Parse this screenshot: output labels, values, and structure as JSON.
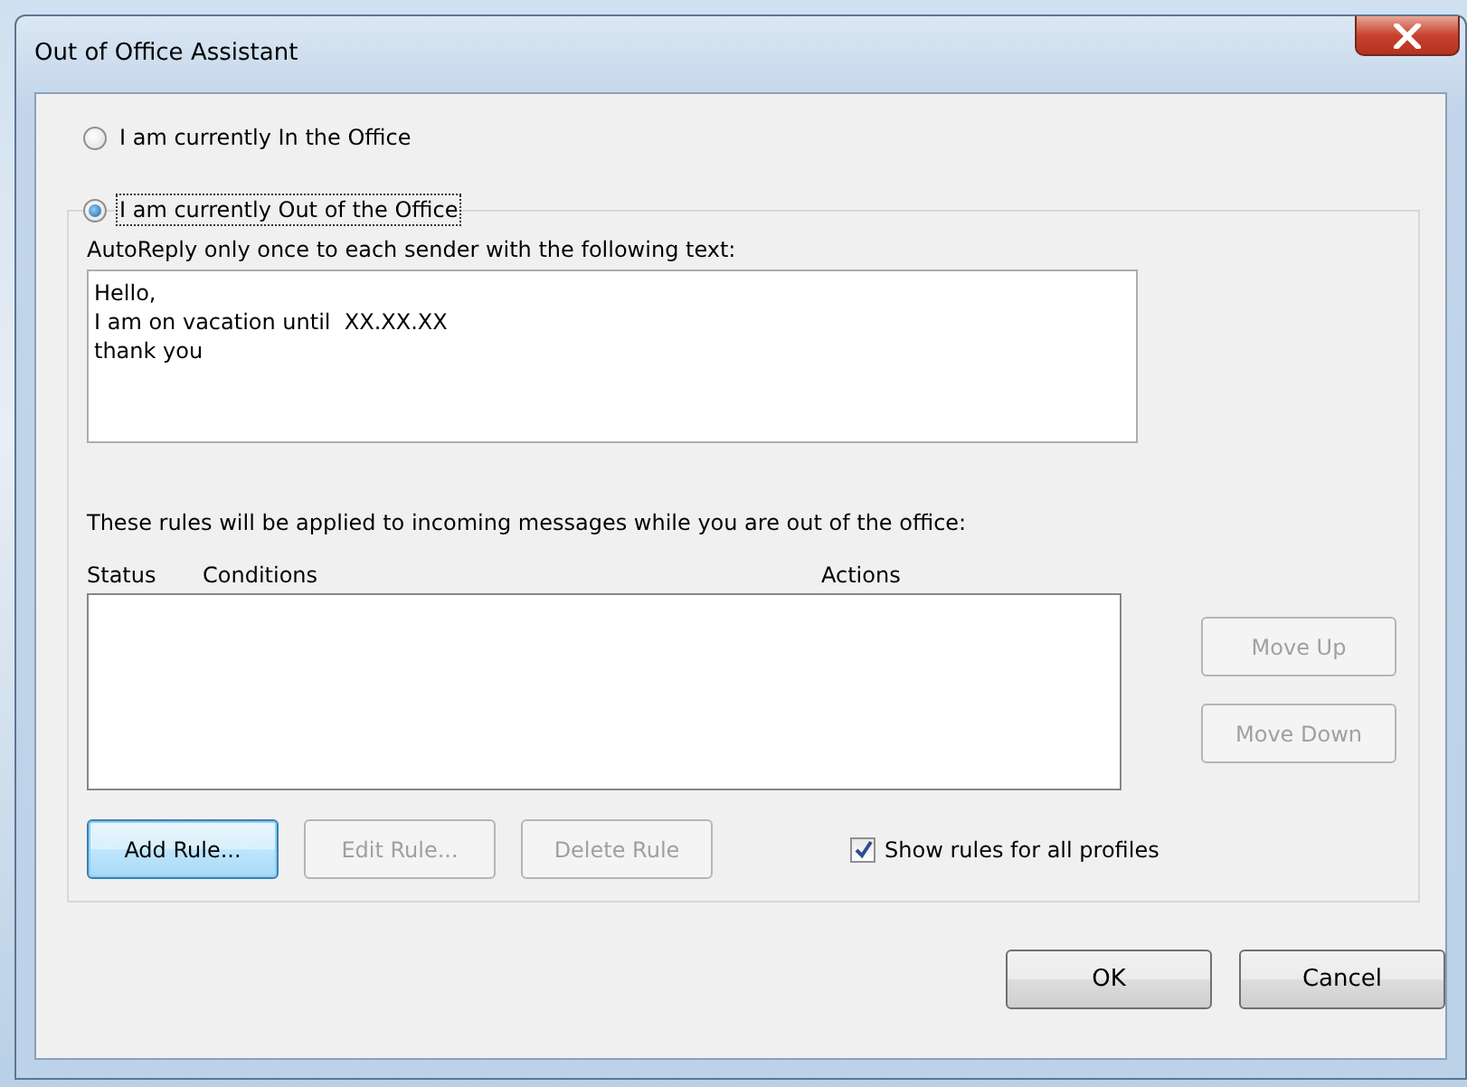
{
  "window": {
    "title": "Out of Office Assistant"
  },
  "status_options": [
    {
      "label": "I am currently In the Office",
      "selected": false,
      "focused": false
    },
    {
      "label": "I am currently Out of the Office",
      "selected": true,
      "focused": true
    }
  ],
  "autoreply": {
    "label": "AutoReply only once to each sender with the following text:",
    "value": "Hello,\nI am on vacation until  XX.XX.XX\nthank you"
  },
  "rules": {
    "label": "These rules will be applied to incoming messages while you are out of the office:",
    "columns": [
      "Status",
      "Conditions",
      "Actions"
    ],
    "side_buttons": [
      {
        "label": "Move Up",
        "disabled": true
      },
      {
        "label": "Move Down",
        "disabled": true
      }
    ],
    "buttons": [
      {
        "label": "Add Rule...",
        "disabled": false,
        "default": true
      },
      {
        "label": "Edit Rule...",
        "disabled": true,
        "default": false
      },
      {
        "label": "Delete Rule",
        "disabled": true,
        "default": false
      }
    ],
    "show_all_profiles": {
      "label": "Show rules for all profiles",
      "checked": true
    }
  },
  "footer_buttons": [
    {
      "label": "OK"
    },
    {
      "label": "Cancel"
    }
  ]
}
